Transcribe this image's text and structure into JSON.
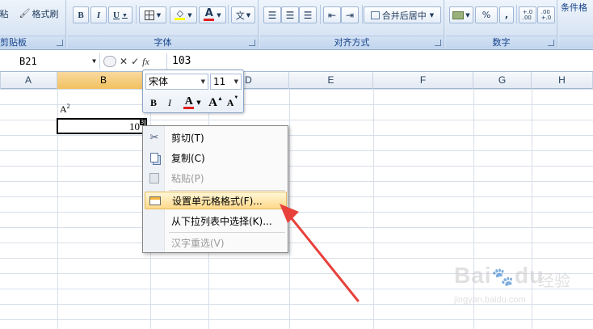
{
  "ribbon": {
    "clipboard": {
      "label": "剪贴板",
      "paste_label": "粘",
      "format_painter_label": "格式刷"
    },
    "font": {
      "label": "字体",
      "bold": "B",
      "italic": "I",
      "underline": "U",
      "font_color_letter": "A",
      "phonetic_label": "文",
      "font_color": "#e02020",
      "highlight_color": "#ffff00"
    },
    "alignment": {
      "label": "对齐方式",
      "merge_center_label": "合并后居中"
    },
    "number": {
      "label": "数字",
      "percent": "%",
      "comma": ",",
      "inc_decimal": "+.0\n.00",
      "dec_decimal": ".00\n+.0"
    },
    "styles": {
      "conditional_label": "条件格"
    }
  },
  "formula_bar": {
    "name_box": "B21",
    "fx_label": "fx",
    "value": "103"
  },
  "sheet": {
    "columns": [
      "A",
      "B",
      "C",
      "D",
      "E",
      "F",
      "G",
      "H"
    ],
    "active_column": "B",
    "cells": {
      "a2_base": "A",
      "a2_sup": "2",
      "active_value": "10",
      "active_sup": "3"
    }
  },
  "mini_toolbar": {
    "font_name": "宋体",
    "font_size": "11",
    "bold": "B",
    "italic": "I",
    "font_color_letter": "A",
    "grow_font": "A",
    "shrink_font": "A"
  },
  "context_menu": {
    "items": [
      {
        "label": "剪切(T)",
        "icon": "scissors-icon",
        "disabled": false,
        "highlight": false
      },
      {
        "label": "复制(C)",
        "icon": "copy-icon",
        "disabled": false,
        "highlight": false
      },
      {
        "label": "粘贴(P)",
        "icon": "paste-icon",
        "disabled": true,
        "highlight": false
      },
      {
        "label": "设置单元格格式(F)...",
        "icon": "format-cells-icon",
        "disabled": false,
        "highlight": true
      },
      {
        "label": "从下拉列表中选择(K)...",
        "icon": "",
        "disabled": false,
        "highlight": false
      },
      {
        "label": "汉字重选(V)",
        "icon": "",
        "disabled": true,
        "highlight": false
      }
    ]
  },
  "watermark": {
    "brand": "Bai",
    "brand_tail": "du",
    "cn": "经验",
    "url": "jingyan.baidu.com"
  },
  "colors": {
    "annotation_arrow": "#e8413c",
    "ribbon_text": "#15428b"
  }
}
